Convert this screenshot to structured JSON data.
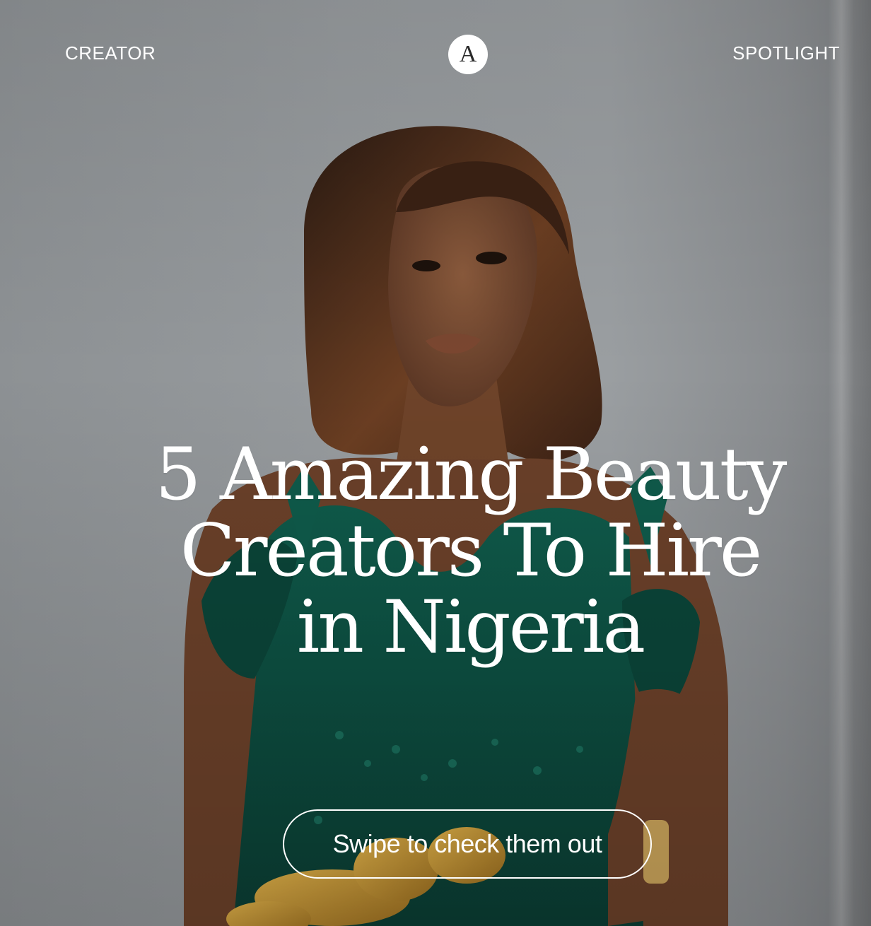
{
  "header": {
    "left_label": "CREATOR",
    "right_label": "SPOTLIGHT",
    "logo_letter": "A"
  },
  "headline": {
    "line1": "5 Amazing Beauty",
    "line2": "Creators To Hire",
    "line3": "in Nigeria"
  },
  "cta": {
    "label": "Swipe to check them out"
  },
  "colors": {
    "text": "#ffffff",
    "logo_bg": "#ffffff",
    "logo_text": "#2a2a2a",
    "dress": "#0f5a4a",
    "background": "#979b9e"
  }
}
